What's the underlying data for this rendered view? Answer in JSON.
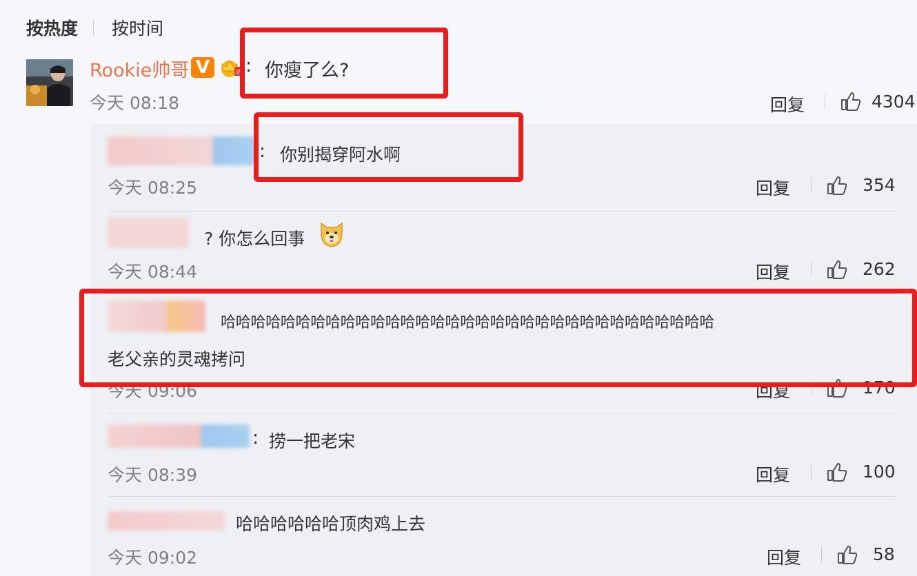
{
  "sort_tabs": {
    "hot_label": "按热度",
    "time_label": "按时间"
  },
  "main_comment": {
    "username": "Rookie帅哥",
    "verified_badge": "V",
    "text": "你瘦了么?",
    "time": "今天 08:18",
    "reply_label": "回复",
    "likes": "4304",
    "icons": [
      "verified-v-icon",
      "crown-icon",
      "thumb-up-icon"
    ]
  },
  "replies": [
    {
      "text": "你别揭穿阿水啊",
      "time": "今天 08:25",
      "reply_label": "回复",
      "likes": "354"
    },
    {
      "text": "? 你怎么回事",
      "time": "今天 08:44",
      "reply_label": "回复",
      "likes": "262",
      "emoji": "doge-emoji"
    },
    {
      "text": "哈哈哈哈哈哈哈哈哈哈哈哈哈哈哈哈哈哈哈哈哈哈哈哈哈哈哈哈哈哈哈哈哈",
      "text_line2": "老父亲的灵魂拷问",
      "time": "今天 09:06",
      "reply_label": "回复",
      "likes": "170"
    },
    {
      "text": "捞一把老宋",
      "time": "今天 08:39",
      "reply_label": "回复",
      "likes": "100"
    },
    {
      "text": "哈哈哈哈哈哈顶肉鸡上去",
      "time": "今天 09:02",
      "reply_label": "回复",
      "likes": "58"
    }
  ],
  "colors": {
    "username": "#eb7350",
    "highlight_box": "#ea1c1c",
    "reply_bg": "#eef0f4",
    "vip_badge": "#ff8200"
  }
}
